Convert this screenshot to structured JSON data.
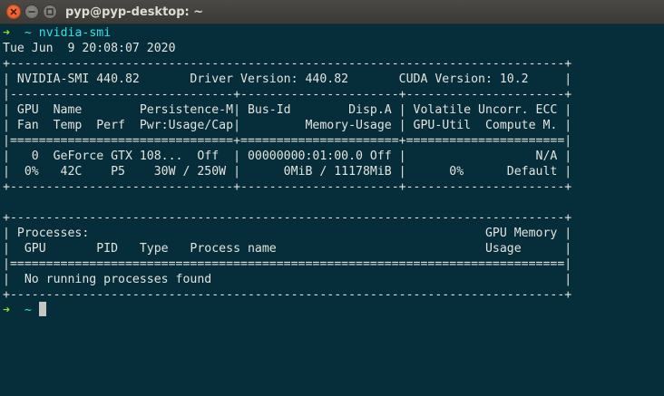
{
  "window": {
    "title": "pyp@pyp-desktop: ~"
  },
  "prompt": {
    "arrow": "➜",
    "cwd": "~"
  },
  "command": "nvidia-smi",
  "lines": [
    "Tue Jun  9 20:08:07 2020",
    "+-----------------------------------------------------------------------------+",
    "| NVIDIA-SMI 440.82       Driver Version: 440.82       CUDA Version: 10.2     |",
    "|-------------------------------+----------------------+----------------------+",
    "| GPU  Name        Persistence-M| Bus-Id        Disp.A | Volatile Uncorr. ECC |",
    "| Fan  Temp  Perf  Pwr:Usage/Cap|         Memory-Usage | GPU-Util  Compute M. |",
    "|===============================+======================+======================|",
    "|   0  GeForce GTX 108...  Off  | 00000000:01:00.0 Off |                  N/A |",
    "|  0%   42C    P5    30W / 250W |      0MiB / 11178MiB |      0%      Default |",
    "+-------------------------------+----------------------+----------------------+",
    "",
    "+-----------------------------------------------------------------------------+",
    "| Processes:                                                       GPU Memory |",
    "|  GPU       PID   Type   Process name                             Usage      |",
    "|=============================================================================|",
    "|  No running processes found                                                 |",
    "+-----------------------------------------------------------------------------+"
  ]
}
